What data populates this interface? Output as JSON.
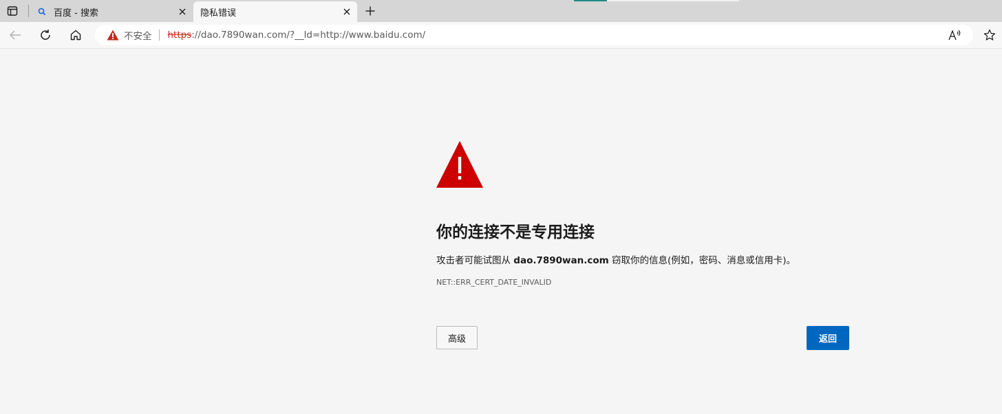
{
  "tabs": [
    {
      "title": "百度 - 搜索",
      "favicon": "search-icon",
      "active": false
    },
    {
      "title": "隐私错误",
      "favicon": "",
      "active": true
    }
  ],
  "address_bar": {
    "security_label": "不安全",
    "url_scheme": "https",
    "url_host": "://dao.7890wan.com",
    "url_rest": "/?__ld=http://www.baidu.com/"
  },
  "error_page": {
    "title": "你的连接不是专用连接",
    "description_before": "攻击者可能试图从 ",
    "description_host": "dao.7890wan.com",
    "description_after": " 窃取你的信息(例如，密码、消息或信用卡)。",
    "error_code": "NET::ERR_CERT_DATE_INVALID",
    "advanced_button": "高级",
    "back_button": "返回"
  },
  "colors": {
    "warning_red": "#cc0000",
    "primary_button": "#0067c0",
    "url_strike_red": "#c42b1c"
  }
}
